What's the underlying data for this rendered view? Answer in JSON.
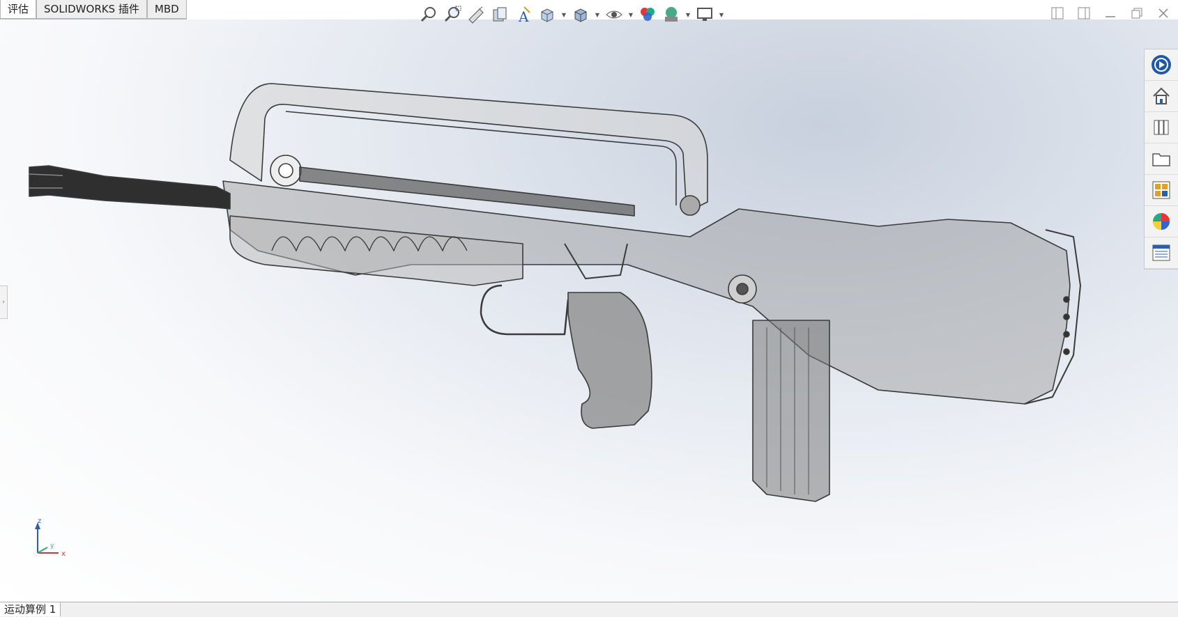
{
  "tabs": [
    {
      "label": "评估"
    },
    {
      "label": "SOLIDWORKS 插件"
    },
    {
      "label": "MBD"
    }
  ],
  "bottom_tab": {
    "label": "运动算例 1"
  },
  "toolbar_icons": [
    "zoom-to-fit-icon",
    "zoom-to-area-icon",
    "previous-view-icon",
    "section-view-icon",
    "dynamic-annotation-icon",
    "view-orientation-icon",
    "display-style-icon",
    "hide-show-items-icon",
    "edit-appearance-icon",
    "apply-scene-icon",
    "view-settings-icon"
  ],
  "taskpane_icons": [
    "solidworks-resources-icon",
    "home-icon",
    "design-library-icon",
    "file-explorer-icon",
    "view-palette-icon",
    "appearances-icon",
    "custom-properties-icon"
  ],
  "triad": {
    "z": "z",
    "y": "y",
    "x": "x"
  },
  "colors": {
    "accent": "#2b5fa8",
    "model_stroke": "#3a3a3a",
    "model_fill": "#8c8c8c"
  }
}
